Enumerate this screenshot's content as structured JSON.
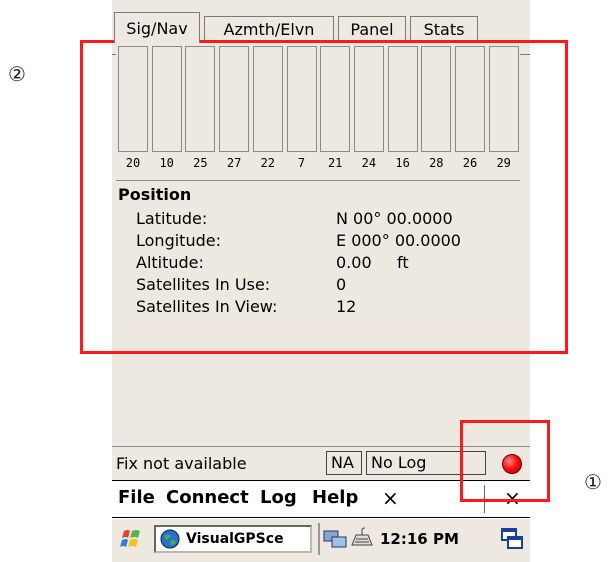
{
  "markers": {
    "region": "②",
    "status": "①"
  },
  "tabs": [
    {
      "label": "Sig/Nav",
      "active": true
    },
    {
      "label": "Azmth/Elvn",
      "active": false
    },
    {
      "label": "Panel",
      "active": false
    },
    {
      "label": "Stats",
      "active": false
    }
  ],
  "satellites": [
    {
      "prn": "20",
      "signal": 0
    },
    {
      "prn": "10",
      "signal": 0
    },
    {
      "prn": "25",
      "signal": 0
    },
    {
      "prn": "27",
      "signal": 0
    },
    {
      "prn": "22",
      "signal": 0
    },
    {
      "prn": "7",
      "signal": 0
    },
    {
      "prn": "21",
      "signal": 0
    },
    {
      "prn": "24",
      "signal": 0
    },
    {
      "prn": "16",
      "signal": 0
    },
    {
      "prn": "28",
      "signal": 0
    },
    {
      "prn": "26",
      "signal": 0
    },
    {
      "prn": "29",
      "signal": 0
    }
  ],
  "position": {
    "title": "Position",
    "rows": [
      {
        "label": "Latitude:",
        "value": "N 00° 00.0000"
      },
      {
        "label": "Longitude:",
        "value": "E 000° 00.0000"
      },
      {
        "label": "Altitude:",
        "value": "0.00     ft"
      },
      {
        "label": "Satellites In Use:",
        "value": "0"
      },
      {
        "label": "Satellites In View:",
        "value": "12"
      }
    ]
  },
  "status": {
    "fix_text": "Fix not available",
    "na_label": "NA",
    "log_label": "No Log",
    "led_color": "#ff1010"
  },
  "menu": {
    "items": [
      "File",
      "Connect",
      "Log",
      "Help"
    ],
    "x_label": "×",
    "close_label": "×"
  },
  "taskbar": {
    "app_label": "VisualGPSce",
    "clock": "12:16 PM",
    "icons": [
      "windows-flag-icon",
      "globe-icon",
      "network-icon",
      "keyboard-icon",
      "desktop-icon"
    ]
  },
  "annotation_color": "#ff1a1a"
}
